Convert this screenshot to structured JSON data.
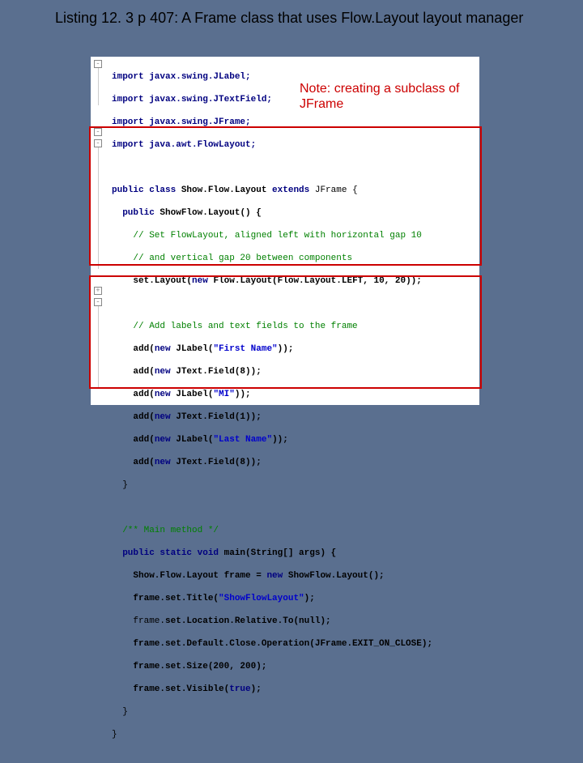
{
  "title": "Listing 12. 3 p 407:  A Frame class that uses Flow.Layout layout manager",
  "note_line1": "Note: creating a subclass of",
  "note_line2": "JFrame",
  "code": {
    "l0": "import javax.swing.JLabel;",
    "l1": "import javax.swing.JTextField;",
    "l2": "import javax.swing.JFrame;",
    "l3": "import java.awt.FlowLayout;",
    "l5a": "public class ",
    "l5b": "Show.Flow.Layout ",
    "l5c": "extends ",
    "l5d": "JFrame {",
    "l6a": "  public ",
    "l6b": "ShowFlow.Layout() {",
    "l7": "    // Set FlowLayout, aligned left with horizontal gap 10",
    "l8": "    // and vertical gap 20 between components",
    "l9a": "    set.Layout(",
    "l9b": "new ",
    "l9c": "Flow.Layout(Flow.Layout.LEFT, 10, 20));",
    "l11": "    // Add labels and text fields to the frame",
    "l12a": "    add(",
    "l12b": "new ",
    "l12c": "JLabel(",
    "l12d": "\"First Name\"",
    "l12e": "));",
    "l13a": "    add(",
    "l13b": "new ",
    "l13c": "JText.Field(8));",
    "l14a": "    add(",
    "l14b": "new ",
    "l14c": "JLabel(",
    "l14d": "\"MI\"",
    "l14e": "));",
    "l15a": "    add(",
    "l15b": "new ",
    "l15c": "JText.Field(1));",
    "l16a": "    add(",
    "l16b": "new ",
    "l16c": "JLabel(",
    "l16d": "\"Last Name\"",
    "l16e": "));",
    "l17a": "    add(",
    "l17b": "new ",
    "l17c": "JText.Field(8));",
    "l18": "  }",
    "l20": "  /** Main method */",
    "l21a": "  public static void ",
    "l21b": "main(String[] args) {",
    "l22a": "    Show.Flow.Layout frame = ",
    "l22b": "new ",
    "l22c": "ShowFlow.Layout();",
    "l23a": "    frame.set.Title(",
    "l23b": "\"ShowFlowLayout\"",
    "l23c": ");",
    "l24a": "    frame.",
    "l24b": "set.Location.Relative.To(null);",
    "l25": "    frame.set.Default.Close.Operation(JFrame.EXIT_ON_CLOSE);",
    "l26": "    frame.set.Size(200, 200);",
    "l27a": "    frame.set.Visible(",
    "l27b": "true",
    "l27c": ");",
    "l28": "  }",
    "l29": "}"
  }
}
